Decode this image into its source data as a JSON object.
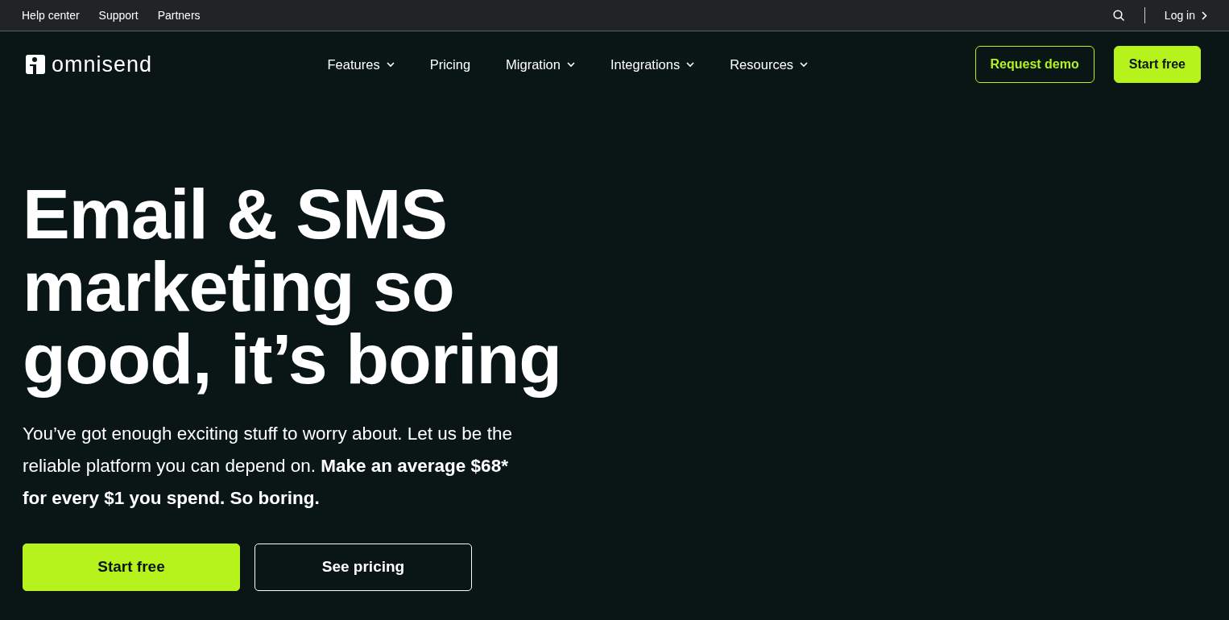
{
  "top_bar": {
    "links": [
      "Help center",
      "Support",
      "Partners"
    ],
    "login": "Log in"
  },
  "navbar": {
    "brand": "omnisend",
    "items": [
      {
        "label": "Features",
        "has_menu": true
      },
      {
        "label": "Pricing",
        "has_menu": false
      },
      {
        "label": "Migration",
        "has_menu": true
      },
      {
        "label": "Integrations",
        "has_menu": true
      },
      {
        "label": "Resources",
        "has_menu": true
      }
    ],
    "buttons": [
      {
        "label": "Request demo",
        "kind": "outline"
      },
      {
        "label": "Start free",
        "kind": "filled"
      }
    ]
  },
  "hero": {
    "headline": "Email & SMS marketing so good, it’s boring",
    "text": "You’ve got enough exciting stuff to worry about. Let us be the reliable platform you can depend on. **Make an average $68* for every $1 you spend. So boring.**",
    "buttons": [
      {
        "label": "Start free",
        "kind": "filled"
      },
      {
        "label": "See pricing",
        "kind": "outline"
      }
    ]
  }
}
